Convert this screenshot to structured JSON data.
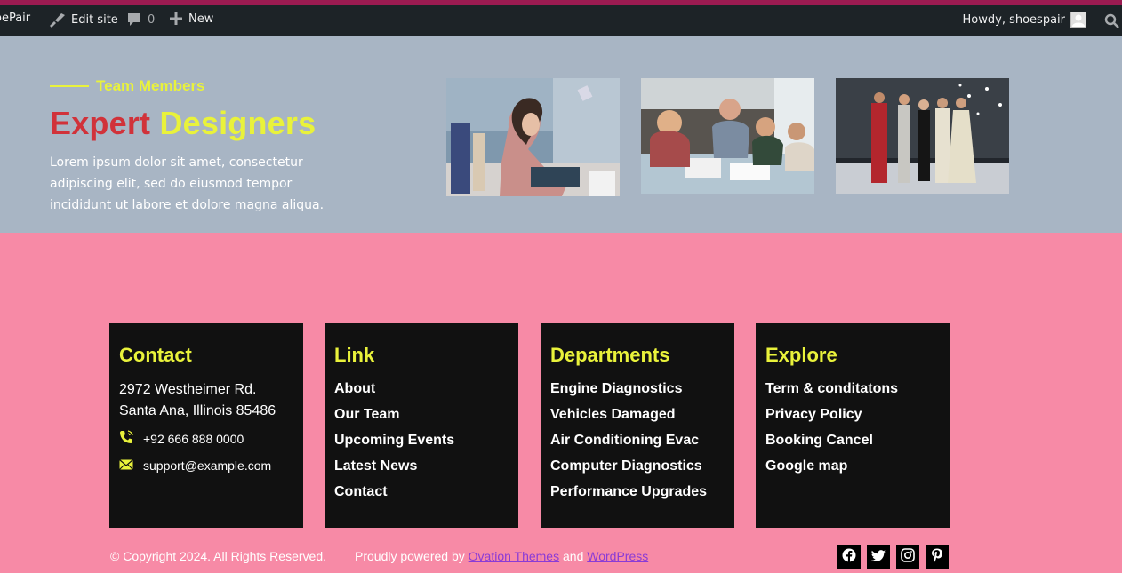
{
  "admin_bar": {
    "site_name": "oePair",
    "edit_site": "Edit site",
    "comments_count": "0",
    "new_label": "New",
    "howdy": "Howdy, shoespair",
    "icons": [
      "wordpress-icon",
      "edit-brush-icon",
      "comment-icon",
      "plus-icon",
      "avatar",
      "search-icon"
    ]
  },
  "team": {
    "kicker": "Team Members",
    "title_word1": "Expert",
    "title_word2": "Designers",
    "description": "Lorem ipsum dolor sit amet, consectetur adipiscing elit, sed do eiusmod tempor incididunt ut labore et dolore magna aliqua."
  },
  "footer": {
    "contact": {
      "heading": "Contact",
      "address_line1": "2972 Westheimer Rd.",
      "address_line2": "Santa Ana, Illinois 85486",
      "phone": "+92 666 888 0000",
      "email": "support@example.com"
    },
    "link": {
      "heading": "Link",
      "items": [
        "About",
        "Our Team",
        "Upcoming Events",
        "Latest News",
        "Contact"
      ]
    },
    "departments": {
      "heading": "Departments",
      "items": [
        "Engine Diagnostics",
        "Vehicles Damaged",
        "Air Conditioning Evac",
        "Computer Diagnostics",
        "Performance Upgrades"
      ]
    },
    "explore": {
      "heading": "Explore",
      "items": [
        "Term & conditatons",
        "Privacy Policy",
        "Booking Cancel",
        "Google map"
      ]
    },
    "copyright": "© Copyright 2024. All Rights Reserved.",
    "powered_prefix": "Proudly powered by",
    "theme_link": "Ovation Themes",
    "and_text": "and",
    "wp_link": "WordPress",
    "social": [
      "facebook-icon",
      "twitter-icon",
      "instagram-icon",
      "pinterest-icon"
    ]
  },
  "colors": {
    "accent_yellow": "#e9f23b",
    "accent_red": "#d1323a",
    "page_pink": "#f78aa6",
    "team_bg": "#a8b5c4",
    "footer_box": "#111111",
    "link_purple": "#8a3bd6"
  }
}
